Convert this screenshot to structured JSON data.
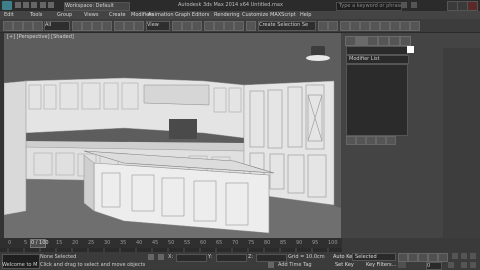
{
  "titlebar": {
    "workspace": "Workspace: Default",
    "file_title": "Autodesk 3ds Max 2014 x64    Untitled.max",
    "search_placeholder": "Type a keyword or phrase"
  },
  "menu": [
    "Edit",
    "Tools",
    "Group",
    "Views",
    "Create",
    "Modifiers",
    "Animation",
    "Graph Editors",
    "Rendering",
    "Customize",
    "MAXScript",
    "Help"
  ],
  "toolbar": {
    "filter_label": "All",
    "view_label": "View",
    "selection_set": "Create Selection Se"
  },
  "viewport": {
    "label": "[+] [Perspective] [Shaded]"
  },
  "command_panel": {
    "modifier_list": "Modifier List"
  },
  "timeline": {
    "slider": "0 / 100",
    "ticks": [
      "0",
      "5",
      "10",
      "15",
      "20",
      "25",
      "30",
      "35",
      "40",
      "45",
      "50",
      "55",
      "60",
      "65",
      "70",
      "75",
      "80",
      "85",
      "90",
      "95",
      "100"
    ]
  },
  "status": {
    "maxscript_label": "Welcome to M",
    "selection_message": "None Selected",
    "prompt": "Click and drag to select and move objects",
    "x_label": "X:",
    "y_label": "Y:",
    "z_label": "Z:",
    "grid": "Grid = 10.0cm",
    "auto_key": "Auto Key",
    "selected": "Selected",
    "set_key": "Set Key",
    "key_filters": "Key Filters...",
    "add_time_tag": "Add Time Tag",
    "frame": "0"
  },
  "colors": {
    "accent": "#3d7f8a",
    "viewport_bg": "#5d5d5d",
    "model": "#e6e6e6",
    "floor": "#7a7a7a"
  }
}
